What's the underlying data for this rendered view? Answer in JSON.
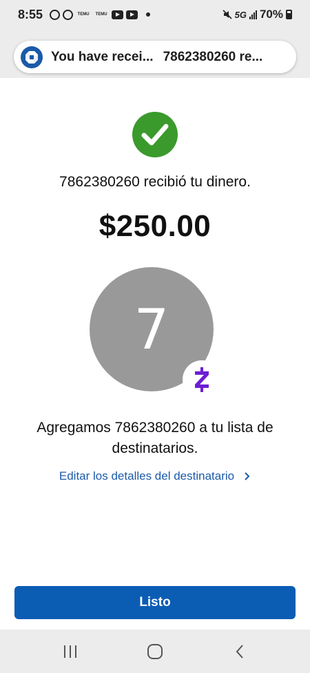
{
  "statusbar": {
    "time": "8:55",
    "network": "5G",
    "battery": "70%",
    "temu_label_1": "TEMU",
    "temu_label_2": "TEMU"
  },
  "notification": {
    "title": "You have recei...",
    "subtitle": "7862380260 re..."
  },
  "confirmation": {
    "message": "7862380260 recibió tu dinero.",
    "amount": "$250.00",
    "avatar_initial": "7",
    "added_message": "Agregamos 7862380260 a tu lista de destinatarios.",
    "edit_link": "Editar los detalles del destinatario"
  },
  "actions": {
    "done_label": "Listo"
  },
  "colors": {
    "success_green": "#3a9a2c",
    "primary_blue": "#0b5db4",
    "link_blue": "#1a5aa8",
    "zelle_purple": "#6d1ed4",
    "avatar_gray": "#999999"
  },
  "icons": {
    "notification_app": "chase-logo-icon",
    "success": "checkmark-icon",
    "badge": "zelle-icon",
    "link_chevron": "chevron-right-icon",
    "nav_recent": "recent-apps-icon",
    "nav_home": "home-icon",
    "nav_back": "back-icon"
  }
}
